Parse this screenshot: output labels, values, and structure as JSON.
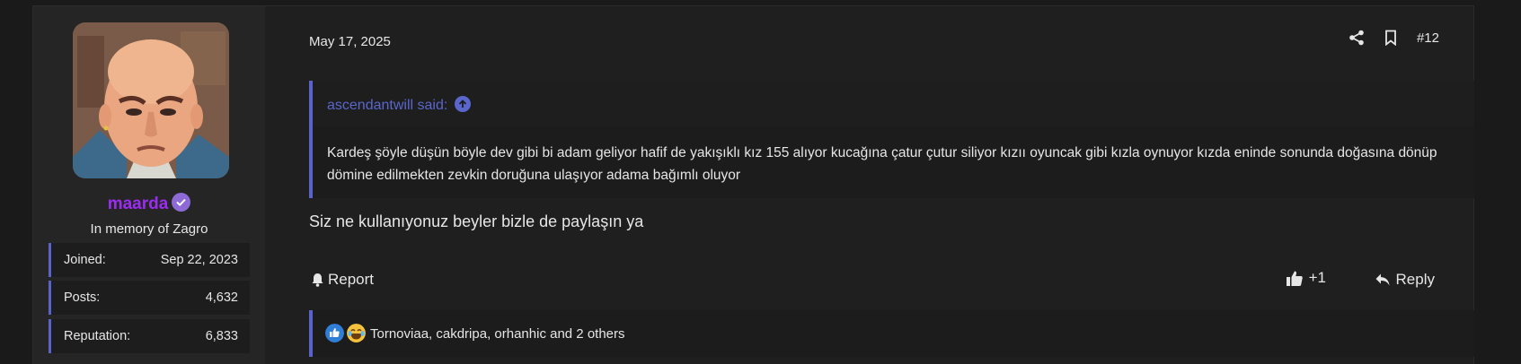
{
  "user": {
    "username": "maarda",
    "title": "In memory of Zagro",
    "stats": [
      {
        "label": "Joined:",
        "value": "Sep 22, 2023"
      },
      {
        "label": "Posts:",
        "value": "4,632"
      },
      {
        "label": "Reputation:",
        "value": "6,833"
      }
    ]
  },
  "post": {
    "date": "May 17, 2025",
    "number": "#12",
    "quote": {
      "author": "ascendantwill said:",
      "body": "Kardeş şöyle düşün böyle dev gibi bi adam geliyor hafif de yakışıklı kız 155 alıyor kucağına çatur çutur siliyor kızıı oyuncak gibi kızla oynuyor kızda eninde sonunda doğasına dönüp dömine edilmekten zevkin doruğuna ulaşıyor adama bağımlı oluyor"
    },
    "message": "Siz ne kullanıyonuz beyler bizle de paylaşın ya",
    "actions": {
      "report": "Report",
      "like_count": "+1",
      "reply": "Reply"
    },
    "reactions": {
      "text": "Tornoviaa, cakdripa, orhanhic and 2 others"
    }
  },
  "colors": {
    "accent": "#5a63c8",
    "username": "#9b2cf0",
    "background": "#1f1f1f"
  }
}
